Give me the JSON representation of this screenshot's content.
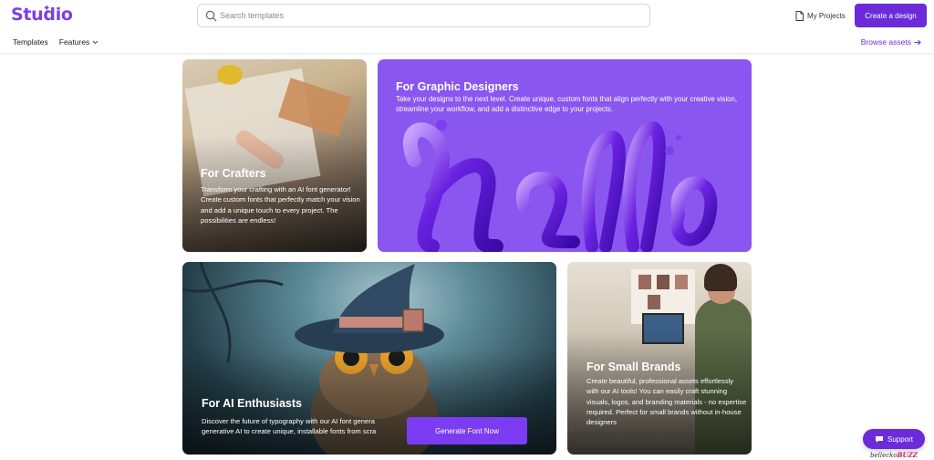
{
  "header": {
    "logo": "Studio",
    "search_placeholder": "Search templates",
    "my_projects": "My Projects",
    "cta": "Create a design"
  },
  "subnav": {
    "items": [
      "Templates",
      "Features"
    ],
    "browse": "Browse assets"
  },
  "cards": {
    "crafters": {
      "title": "For Crafters",
      "text": "Transform your crafting with an AI font generator! Create custom fonts that perfectly match your vision and add a unique touch to every project. The possibilities are endless!"
    },
    "designers": {
      "title": "For Graphic Designers",
      "text": "Take your designs to the next level. Create unique, custom fonts that align perfectly with your creative vision, streamline your workflow, and add a distinctive edge to your projects.",
      "art_word": "Hello"
    },
    "ai": {
      "title": "For AI Enthusiasts",
      "line1": "Discover the future of typography with our AI font genera",
      "line2": "generative AI to create unique, installable fonts from scra",
      "button": "Generate Font Now"
    },
    "brands": {
      "title": "For Small Brands",
      "text": "Create beautiful, professional assets effortlessly with our AI tools! You can easily craft stunning visuals, logos, and branding materials - no expertise required. Perfect for small brands without in-house designers"
    }
  },
  "support": "Support",
  "watermark": {
    "prefix": "bellecko",
    "suffix": "BUZZ"
  },
  "colors": {
    "brand": "#6c2bd9",
    "designers_bg": "#8a56f0"
  }
}
